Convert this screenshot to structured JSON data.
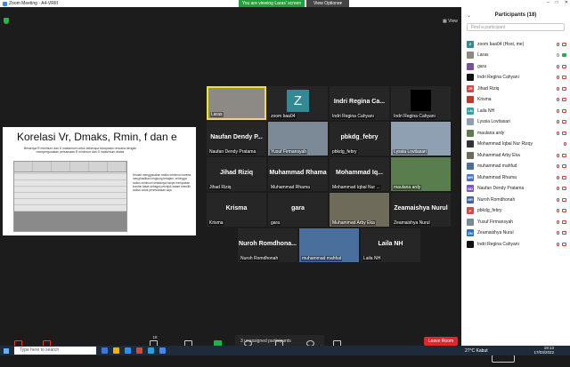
{
  "window": {
    "title": "Zoom Meeting - A4-VRIII"
  },
  "banner": {
    "viewing": "You are viewing Laras' screen",
    "view_options": "View Options"
  },
  "view_btn": "View",
  "slide": {
    "title": "Korelasi Vr, Dmaks, Rmin, f dan e",
    "subtitle": "Besarnya R minimum dan D maksimum untuk beberapa kecepatan rencana dengan mempergunakan persamaan R minimum dan D maksimum diatas",
    "text": "Hindari menggunakan radius minimum karena menghasilkan lengkung tertajam, sehingga radius minimum sebaiknya hanya merupakan kondisi batas sebagai petunjuk dalam memilih radius untuk perencanaan saja"
  },
  "tiles": [
    {
      "name": "Laras",
      "big": "",
      "kind": "photo",
      "color": "#8d8a85",
      "active": true
    },
    {
      "name": "zoom baa04",
      "big": "",
      "kind": "z"
    },
    {
      "name": "Indri Regina Cahyani",
      "big": "Indri Regina Ca..."
    },
    {
      "name": "Indri Regina Cahyani",
      "big": "",
      "kind": "black"
    },
    {
      "name": "Naufan Dendy Pratama",
      "big": "Naufan Dendy P..."
    },
    {
      "name": "Yusuf Firmansyah",
      "big": "",
      "kind": "photo",
      "color": "#7b8a96"
    },
    {
      "name": "pbkdg_febry",
      "big": "pbkdg_febry"
    },
    {
      "name": "Lyssia Lovitasari",
      "big": "",
      "kind": "photo",
      "color": "#8fa0b3"
    },
    {
      "name": "Jihad Riziq",
      "big": "Jihad Riziq"
    },
    {
      "name": "Muhammad Rhama",
      "big": "Muhammad Rhama"
    },
    {
      "name": "Mohammad Iqbal Nur ...",
      "big": "Mohammad Iq..."
    },
    {
      "name": "maulana ardy",
      "big": "",
      "kind": "photo",
      "color": "#5a7d4e"
    },
    {
      "name": "Krisma",
      "big": "Krisma"
    },
    {
      "name": "gara",
      "big": "gara"
    },
    {
      "name": "Muhammad Arby Eka",
      "big": "",
      "kind": "photo",
      "color": "#6e6b5a"
    },
    {
      "name": "Zeamaishya Nurul",
      "big": "Zeamaishya Nurul"
    },
    {
      "name": "Nuroh Romdhonah",
      "big": "Nuroh Romdhona..."
    },
    {
      "name": "muhammad mahfud",
      "big": "",
      "kind": "photo",
      "color": "#4a6f9c"
    },
    {
      "name": "Laila NH",
      "big": "Laila NH"
    }
  ],
  "unassigned": "3 unassigned participants",
  "toolbar": {
    "unmute": "Unmute",
    "start_video": "Start Video",
    "participants": "Participants",
    "participants_count": "18",
    "chat": "Chat",
    "share": "Share Screen",
    "record": "Record",
    "breakout": "Breakout Rooms",
    "reactions": "Reactions",
    "apps": "Apps",
    "leave": "Leave Room"
  },
  "panel": {
    "title": "Participants (18)",
    "search_placeholder": "Find a participant",
    "mute_all": "Mute All",
    "participants": [
      {
        "name": "zoom baa04 (Host, me)",
        "initials": "Z",
        "color": "#338a95",
        "mic": "red",
        "cam": "red"
      },
      {
        "name": "Laras",
        "initials": "",
        "color": "#8d8a85",
        "mic": "gray",
        "cam": "green"
      },
      {
        "name": "gara",
        "initials": "",
        "color": "#7a4f9a",
        "mic": "red",
        "cam": "red"
      },
      {
        "name": "Indri Regina Cahyani",
        "initials": "",
        "color": "#111111",
        "mic": "red",
        "cam": "red"
      },
      {
        "name": "Jihad Riziq",
        "initials": "JR",
        "color": "#d64949",
        "mic": "red",
        "cam": "red"
      },
      {
        "name": "Krisma",
        "initials": "",
        "color": "#c0392b",
        "mic": "red",
        "cam": "red"
      },
      {
        "name": "Laila NH",
        "initials": "LN",
        "color": "#2ea3a3",
        "mic": "red",
        "cam": "red"
      },
      {
        "name": "Lyssia Lovitasari",
        "initials": "",
        "color": "#8fa0b3",
        "mic": "red",
        "cam": "red"
      },
      {
        "name": "maulana ardy",
        "initials": "",
        "color": "#5a7d4e",
        "mic": "red",
        "cam": "red"
      },
      {
        "name": "Mohammad Iqbal Nur Rizqy",
        "initials": "",
        "color": "#333333",
        "mic": "red",
        "cam": ""
      },
      {
        "name": "Muhammad Arby Eka",
        "initials": "",
        "color": "#6e6b5a",
        "mic": "red",
        "cam": "red"
      },
      {
        "name": "muhammad mahfud",
        "initials": "",
        "color": "#4a6f9c",
        "mic": "red",
        "cam": "red"
      },
      {
        "name": "Muhammad Rhama",
        "initials": "MR",
        "color": "#4b6fd1",
        "mic": "red",
        "cam": "red"
      },
      {
        "name": "Naufan Dendy Pratama",
        "initials": "ND",
        "color": "#7a56c9",
        "mic": "red",
        "cam": "red"
      },
      {
        "name": "Nuroh Romdhonah",
        "initials": "NR",
        "color": "#3f5fa6",
        "mic": "red",
        "cam": "red"
      },
      {
        "name": "pbkdg_febry",
        "initials": "P",
        "color": "#d64949",
        "mic": "red",
        "cam": "red"
      },
      {
        "name": "Yusuf Firmansyah",
        "initials": "",
        "color": "#7b8a96",
        "mic": "red",
        "cam": "red"
      },
      {
        "name": "Zeamaishya Nurul",
        "initials": "ZN",
        "color": "#2d73c4",
        "mic": "red",
        "cam": "red"
      },
      {
        "name": "Indri Regina Cahyani",
        "initials": "",
        "color": "#111111",
        "mic": "red",
        "cam": "red"
      }
    ]
  },
  "taskbar": {
    "search": "Type here to search",
    "weather": "27°C Kabut",
    "time": "19:13",
    "date": "17/03/2022"
  }
}
